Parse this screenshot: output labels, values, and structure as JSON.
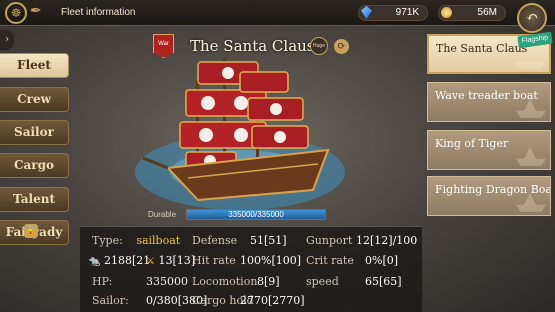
{
  "header": {
    "title": "Fleet information",
    "gems": "971K",
    "gold": "56M",
    "back_icon": "back-arrow-icon",
    "flagship_badge": "Flagship"
  },
  "tabs": [
    {
      "label": "Fleet",
      "active": true
    },
    {
      "label": "Crew",
      "active": false
    },
    {
      "label": "Sailor",
      "active": false
    },
    {
      "label": "Cargo",
      "active": false
    },
    {
      "label": "Talent",
      "active": false
    },
    {
      "label": "Fairyady",
      "active": false,
      "locked": true
    }
  ],
  "ship": {
    "war_badge": "War",
    "name": "The Santa Claus",
    "size_badge": "Huge",
    "durable_label": "Durable",
    "durable_text": "335000/335000",
    "durable_ratio": 1.0
  },
  "ship_list": [
    {
      "name": "The Santa Claus",
      "active": true
    },
    {
      "name": "Wave treader boat",
      "active": false
    },
    {
      "name": "King of Tiger",
      "active": false
    },
    {
      "name": "Fighting Dragon Boat",
      "active": false
    }
  ],
  "stats": {
    "type_label": "Type:",
    "type_value": "sailboat",
    "attack_value": "2188[21",
    "swords_value": "13[13]",
    "hp_label": "HP:",
    "hp_value": "335000",
    "sailor_label": "Sailor:",
    "sailor_value": "0/380[380]",
    "defense_label": "Defense",
    "defense_value": "51[51]",
    "hit_rate_label": "Hit rate",
    "hit_rate_value": "100%[100]",
    "locomotion_label": "Locomotion",
    "locomotion_value": "8[9]",
    "cargo_hold_label": "Cargo hold",
    "cargo_hold_value": "2770[2770]",
    "gunport_label": "Gunport",
    "gunport_value": "12[12]/100",
    "crit_rate_label": "Crit rate",
    "crit_rate_value": "0%[0]",
    "speed_label": "speed",
    "speed_value": "65[65]"
  },
  "colors": {
    "accent_gold": "#c9a25a",
    "type_value": "#f0c23c",
    "tab_active": "#f6e6c4",
    "durable_fill": "#3f93d6"
  }
}
